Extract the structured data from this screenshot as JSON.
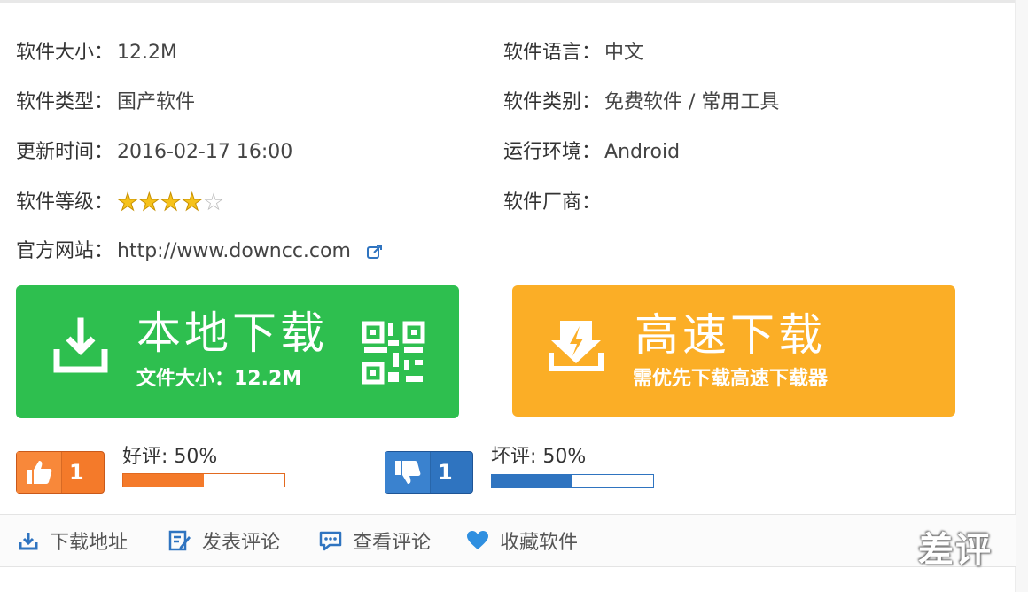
{
  "info": {
    "size": {
      "label": "软件大小：",
      "value": "12.2M"
    },
    "language": {
      "label": "软件语言：",
      "value": "中文"
    },
    "type": {
      "label": "软件类型：",
      "value": "国产软件"
    },
    "category": {
      "label": "软件类别：",
      "value": "免费软件 / 常用工具"
    },
    "updated": {
      "label": "更新时间：",
      "value": "2016-02-17 16:00"
    },
    "environment": {
      "label": "运行环境：",
      "value": "Android"
    },
    "rating": {
      "label": "软件等级：",
      "stars": 4,
      "max_stars": 5
    },
    "vendor": {
      "label": "软件厂商：",
      "value": ""
    },
    "website": {
      "label": "官方网站：",
      "value": "http://www.downcc.com"
    }
  },
  "download": {
    "local": {
      "title": "本地下载",
      "subtitle": "文件大小：12.2M",
      "color": "#2ebf4f"
    },
    "fast": {
      "title": "高速下载",
      "subtitle": "需优先下载高速下载器",
      "color": "#fbae26"
    }
  },
  "votes": {
    "good": {
      "count": "1",
      "label": "好评: 50%",
      "percent": 50,
      "color": "#f47a2a"
    },
    "bad": {
      "count": "1",
      "label": "坏评: 50%",
      "percent": 50,
      "color": "#2f74c0"
    }
  },
  "actions": [
    {
      "label": "下载地址",
      "icon": "download-address-icon"
    },
    {
      "label": "发表评论",
      "icon": "edit-comment-icon"
    },
    {
      "label": "查看评论",
      "icon": "view-comments-icon"
    },
    {
      "label": "收藏软件",
      "icon": "heart-icon"
    }
  ],
  "watermark": "差评"
}
